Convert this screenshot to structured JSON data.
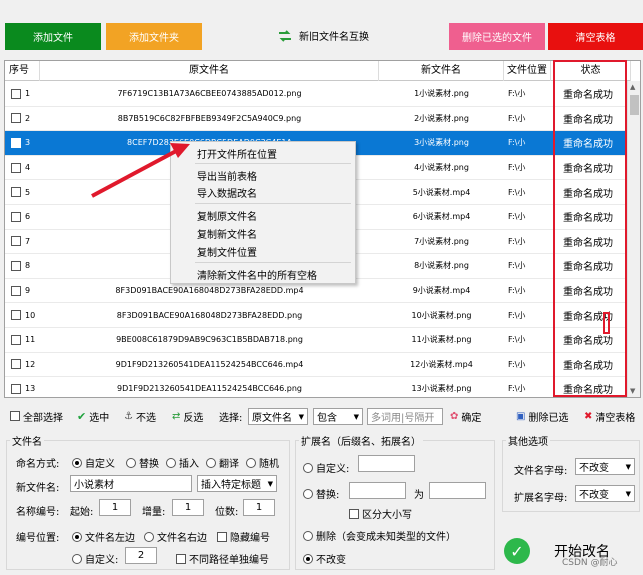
{
  "toolbar": {
    "add_file": "添加文件",
    "add_folder": "添加文件夹",
    "swap": "新旧文件名互换",
    "remove_selected": "删除已选的文件",
    "clear_table": "清空表格"
  },
  "table": {
    "columns": [
      "序号",
      "原文件名",
      "新文件名",
      "文件位置",
      "状态"
    ],
    "rows": [
      {
        "no": "1",
        "orig": "7F6719C13B1A73A6CBEE0743885AD012.png",
        "new": "1小说素材.png",
        "loc": "F:\\小",
        "status": "重命名成功"
      },
      {
        "no": "2",
        "orig": "8B7B519C6C82FBFBEB9349F2C5A940C9.png",
        "new": "2小说素材.png",
        "loc": "F:\\小",
        "status": "重命名成功"
      },
      {
        "no": "3",
        "orig": "8CEF7D283E6E0C6DBC5DEAD0C3C4E1A",
        "new": "3小说素材.png",
        "loc": "F:\\小",
        "status": "重命名成功"
      },
      {
        "no": "4",
        "orig": "8D731529917",
        "new": "4小说素材.png",
        "loc": "F:\\小",
        "status": "重命名成功"
      },
      {
        "no": "5",
        "orig": "8E2CA0BD7CB2",
        "new": "5小说素材.mp4",
        "loc": "F:\\小",
        "status": "重命名成功"
      },
      {
        "no": "6",
        "orig": "8E2CA0BD7CB2",
        "new": "6小说素材.mp4",
        "loc": "F:\\小",
        "status": "重命名成功"
      },
      {
        "no": "7",
        "orig": "8E44E10D83FAD",
        "new": "7小说素材.png",
        "loc": "F:\\小",
        "status": "重命名成功"
      },
      {
        "no": "8",
        "orig": "8E44E10D83FAD",
        "new": "8小说素材.png",
        "loc": "F:\\小",
        "status": "重命名成功"
      },
      {
        "no": "9",
        "orig": "8F3D091BACE90A168048D273BFA28EDD.mp4",
        "new": "9小说素材.mp4",
        "loc": "F:\\小",
        "status": "重命名成功"
      },
      {
        "no": "10",
        "orig": "8F3D091BACE90A168048D273BFA28EDD.png",
        "new": "10小说素材.png",
        "loc": "F:\\小",
        "status": "重命名成功"
      },
      {
        "no": "11",
        "orig": "9BE008C61879D9AB9C963C1B5BDAB718.png",
        "new": "11小说素材.png",
        "loc": "F:\\小",
        "status": "重命名成功"
      },
      {
        "no": "12",
        "orig": "9D1F9D213260541DEA11524254BCC646.mp4",
        "new": "12小说素材.mp4",
        "loc": "F:\\小",
        "status": "重命名成功"
      },
      {
        "no": "13",
        "orig": "9D1F9D213260541DEA11524254BCC646.png",
        "new": "13小说素材.png",
        "loc": "F:\\小",
        "status": "重命名成功"
      }
    ]
  },
  "context_menu": {
    "items": [
      "打开文件所在位置",
      "导出当前表格",
      "导入数据改名",
      "复制原文件名",
      "复制新文件名",
      "复制文件位置",
      "清除新文件名中的所有空格"
    ]
  },
  "selbar": {
    "select_all": "全部选择",
    "check": "选中",
    "uncheck": "不选",
    "invert": "反选",
    "select_label": "选择:",
    "field_value": "原文件名",
    "mode_value": "包含",
    "keyword_placeholder": "多词用|号隔开",
    "confirm": "确定",
    "delete_checked": "删除已选",
    "clear_table": "清空表格"
  },
  "filename": {
    "group_title": "文件名",
    "mode_label": "命名方式:",
    "modes": [
      "自定义",
      "替换",
      "插入",
      "翻译",
      "随机"
    ],
    "newname_label": "新文件名:",
    "newname_value": "小说素材",
    "insert_value": "插入特定标题",
    "num_label": "名称编号:",
    "start_label": "起始:",
    "start_value": "1",
    "inc_label": "增量:",
    "inc_value": "1",
    "digits_label": "位数:",
    "digits_value": "1",
    "pos_label": "编号位置:",
    "pos_left": "文件名左边",
    "pos_right": "文件名右边",
    "hide_num": "隐藏编号",
    "custom_label": "自定义:",
    "custom_value": "2",
    "per_path": "不同路径单独编号"
  },
  "ext": {
    "group_title": "扩展名（后缀名、拓展名）",
    "custom": "自定义:",
    "replace": "替换:",
    "to": "为",
    "case": "区分大小写",
    "delete": "删除（会变成未知类型的文件）",
    "nochange": "不改变"
  },
  "other": {
    "group_title": "其他选项",
    "fname_case_label": "文件名字母:",
    "fname_case_value": "不改变",
    "ext_case_label": "扩展名字母:",
    "ext_case_value": "不改变"
  },
  "start_label": "开始改名",
  "watermark": "CSDN @耐心"
}
